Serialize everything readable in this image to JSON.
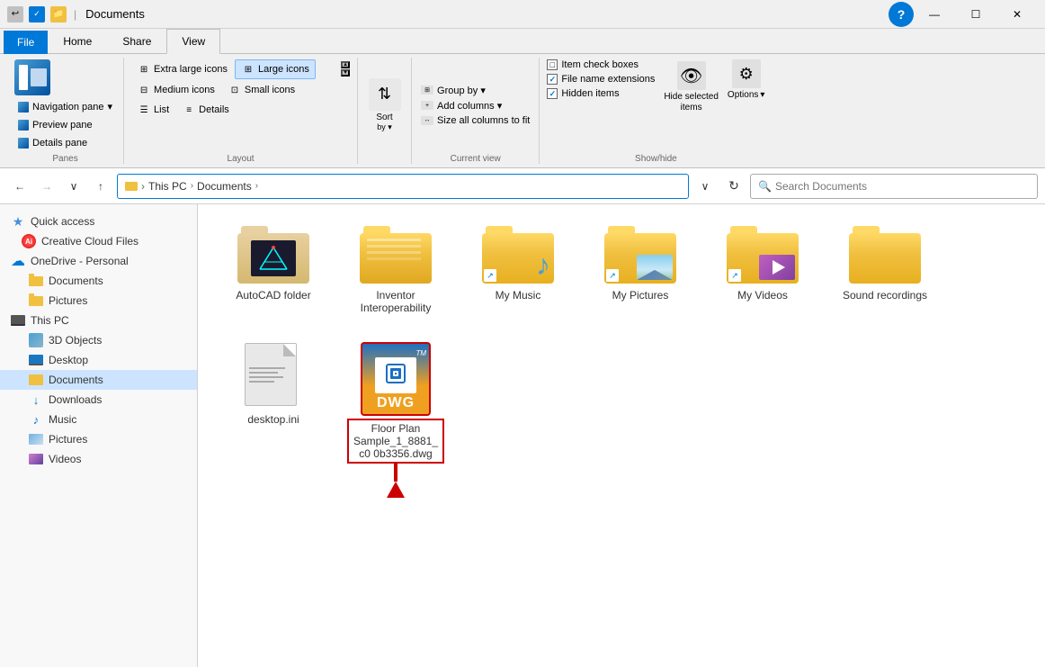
{
  "titlebar": {
    "title": "Documents",
    "minimize_label": "—",
    "maximize_label": "☐",
    "close_label": "✕"
  },
  "ribbon": {
    "tabs": [
      "File",
      "Home",
      "Share",
      "View"
    ],
    "active_tab": "View",
    "groups": {
      "panes": {
        "label": "Panes",
        "navigation_pane": "Navigation pane",
        "navigation_arrow": "▾",
        "preview_pane": "Preview pane",
        "details_pane": "Details pane"
      },
      "layout": {
        "label": "Layout",
        "options": [
          "Extra large icons",
          "Large icons",
          "Medium icons",
          "Small icons",
          "List",
          "Details"
        ],
        "active": "Large icons"
      },
      "sort": {
        "label": "Sort by ▾"
      },
      "current_view": {
        "label": "Current view",
        "group_by": "Group by ▾",
        "add_columns": "Add columns ▾",
        "size_all": "Size all columns to fit"
      },
      "show_hide": {
        "label": "Show/hide",
        "item_check_boxes": "Item check boxes",
        "file_name_extensions": "File name extensions",
        "hidden_items": "Hidden items",
        "file_name_extensions_checked": true,
        "hidden_items_checked": true,
        "hide_selected": "Hide selected items",
        "options": "Options",
        "options_arrow": "▾"
      }
    }
  },
  "address_bar": {
    "back_label": "←",
    "forward_label": "→",
    "history_label": "∨",
    "up_label": "↑",
    "path_parts": [
      "This PC",
      "Documents"
    ],
    "refresh_label": "↻",
    "search_placeholder": "Search Documents"
  },
  "sidebar": {
    "quick_access": "Quick access",
    "creative_cloud": "Creative Cloud Files",
    "onedrive": "OneDrive - Personal",
    "onedrive_items": [
      "Documents",
      "Pictures"
    ],
    "this_pc": "This PC",
    "this_pc_items": [
      "3D Objects",
      "Desktop",
      "Documents",
      "Downloads",
      "Music",
      "Pictures",
      "Videos"
    ]
  },
  "files": [
    {
      "id": "autocad",
      "name": "AutoCAD folder",
      "type": "folder-autocad"
    },
    {
      "id": "inventor",
      "name": "Inventor Interoperability",
      "type": "folder-plain"
    },
    {
      "id": "my-music",
      "name": "My Music",
      "type": "folder-music"
    },
    {
      "id": "my-pictures",
      "name": "My Pictures",
      "type": "folder-pictures"
    },
    {
      "id": "my-videos",
      "name": "My Videos",
      "type": "folder-videos"
    },
    {
      "id": "sound-recordings",
      "name": "Sound recordings",
      "type": "folder-plain"
    },
    {
      "id": "desktop-ini",
      "name": "desktop.ini",
      "type": "file-ini"
    },
    {
      "id": "floor-plan",
      "name": "Floor Plan Sample_1_8881_c00b3356.dwg",
      "type": "file-dwg",
      "selected": true
    }
  ],
  "arrow": {
    "visible": true
  }
}
